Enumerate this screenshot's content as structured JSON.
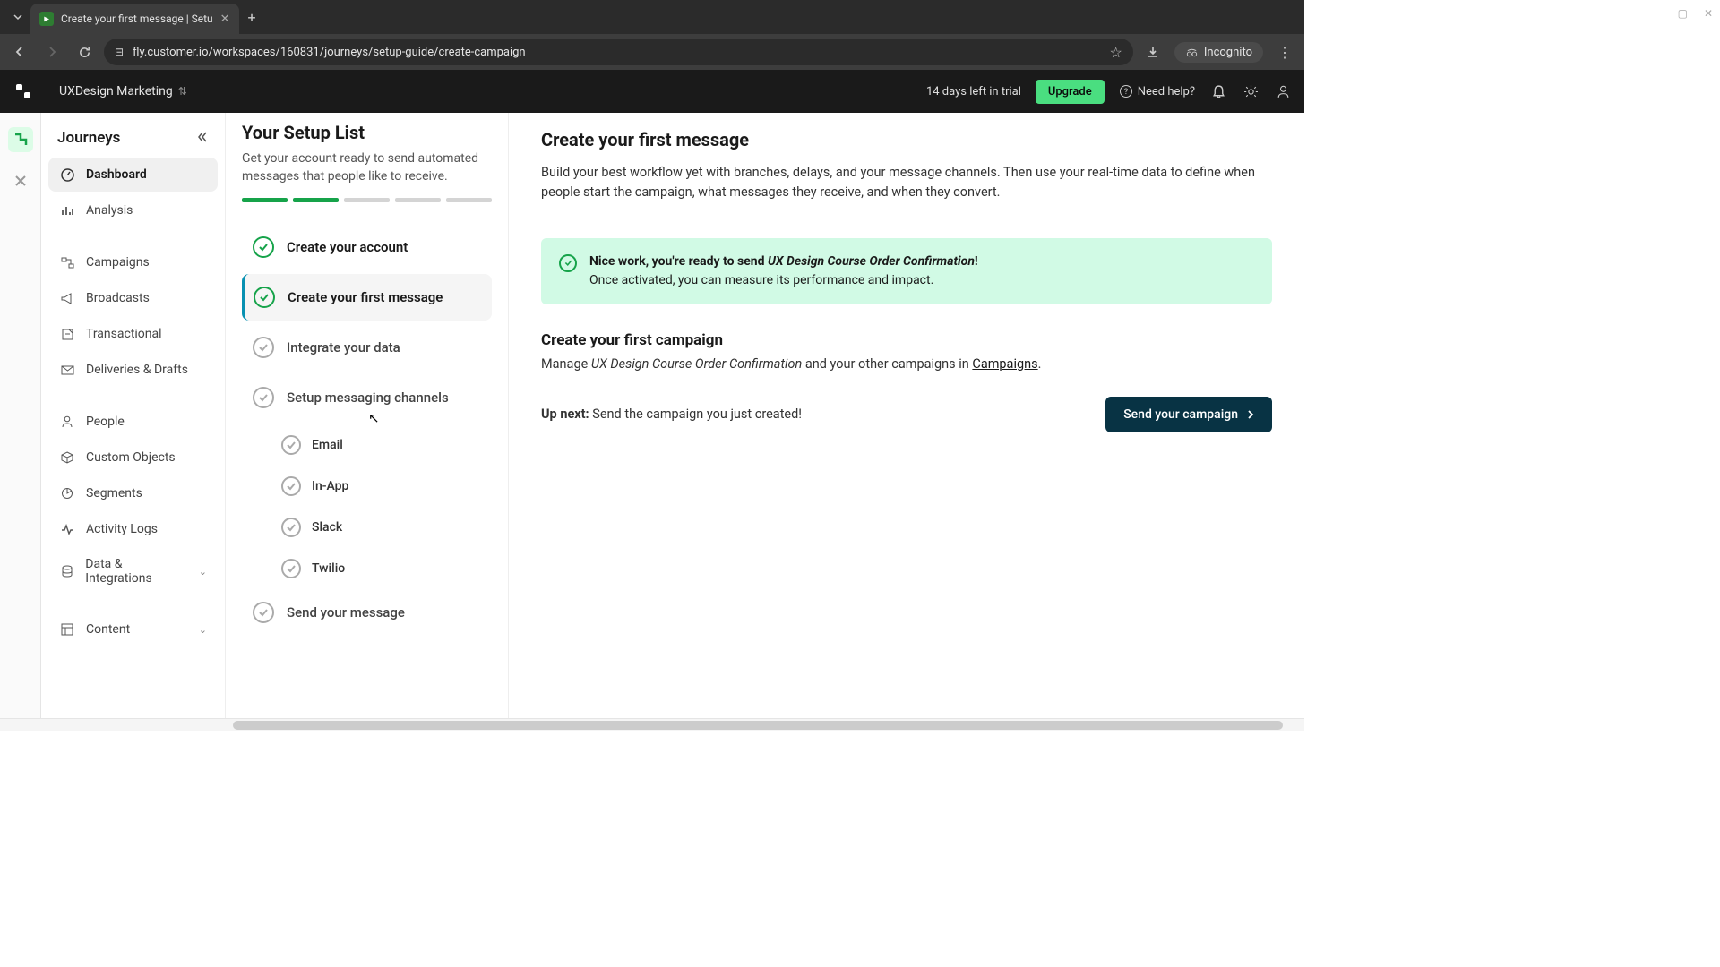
{
  "browser": {
    "tab_title": "Create your first message | Setu",
    "url": "fly.customer.io/workspaces/160831/journeys/setup-guide/create-campaign",
    "incognito": "Incognito"
  },
  "topbar": {
    "workspace": "UXDesign Marketing",
    "trial": "14 days left in trial",
    "upgrade": "Upgrade",
    "help": "Need help?"
  },
  "sidebar": {
    "title": "Journeys",
    "items": [
      {
        "label": "Dashboard"
      },
      {
        "label": "Analysis"
      },
      {
        "label": "Campaigns"
      },
      {
        "label": "Broadcasts"
      },
      {
        "label": "Transactional"
      },
      {
        "label": "Deliveries & Drafts"
      },
      {
        "label": "People"
      },
      {
        "label": "Custom Objects"
      },
      {
        "label": "Segments"
      },
      {
        "label": "Activity Logs"
      },
      {
        "label": "Data & Integrations"
      },
      {
        "label": "Content"
      }
    ]
  },
  "setup": {
    "title": "Your Setup List",
    "desc": "Get your account ready to send automated messages that people like to receive.",
    "steps": {
      "s1": "Create your account",
      "s2": "Create your first message",
      "s3": "Integrate your data",
      "s4": "Setup messaging channels",
      "s4a": "Email",
      "s4b": "In-App",
      "s4c": "Slack",
      "s4d": "Twilio",
      "s5": "Send your message"
    }
  },
  "main": {
    "title": "Create your first message",
    "desc": "Build your best workflow yet with branches, delays, and your message channels. Then use your real-time data to define when people start the campaign, what messages they receive, and when they convert.",
    "banner_lead": "Nice work, you're ready to send ",
    "banner_campaign": "UX Design Course Order Confirmation",
    "banner_tail": "!",
    "banner_sub": "Once activated, you can measure its performance and impact.",
    "section_title": "Create your first campaign",
    "manage_pre": "Manage ",
    "manage_em": "UX Design Course Order Confirmation",
    "manage_mid": " and your other campaigns in ",
    "manage_link": "Campaigns",
    "manage_post": ".",
    "upnext_label": "Up next:",
    "upnext_text": " Send the campaign you just created!",
    "cta": "Send your campaign"
  }
}
